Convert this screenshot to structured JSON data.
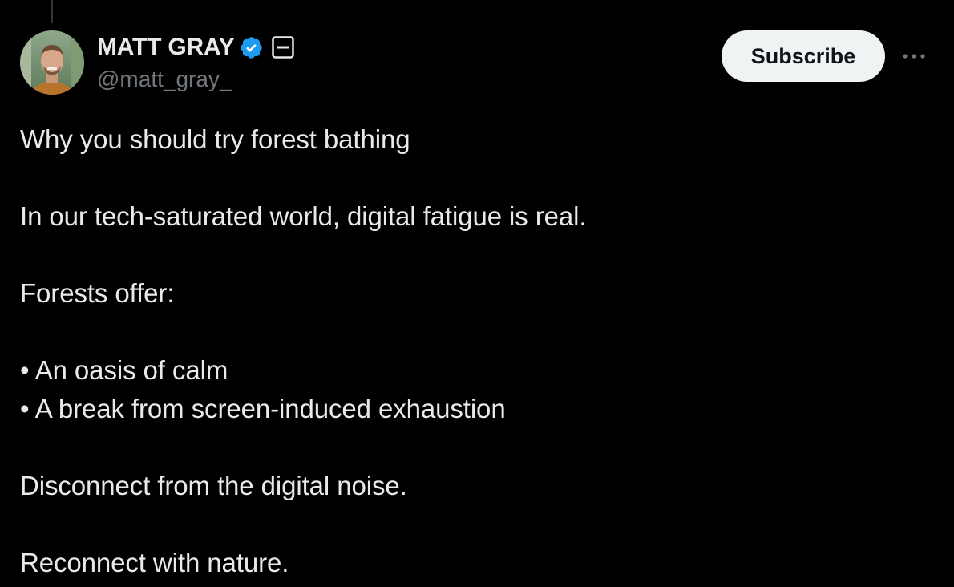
{
  "author": {
    "display_name": "MATT GRAY",
    "handle": "@matt_gray_",
    "verified_icon": "verified-badge-icon",
    "affiliation_icon": "affiliate-badge-icon"
  },
  "actions": {
    "subscribe_label": "Subscribe",
    "more_icon": "more-options-icon"
  },
  "tweet": {
    "lines": [
      "Why you should try forest bathing",
      "",
      "In our tech-saturated world, digital fatigue is real.",
      "",
      "Forests offer:",
      "",
      "• An oasis of calm",
      "• A break from screen-induced exhaustion",
      "",
      "Disconnect from the digital noise.",
      "",
      "Reconnect with nature."
    ]
  },
  "colors": {
    "background": "#000000",
    "text_primary": "#e7e9ea",
    "text_secondary": "#71767b",
    "verified_blue": "#1d9bf0",
    "button_bg": "#eff3f4"
  }
}
